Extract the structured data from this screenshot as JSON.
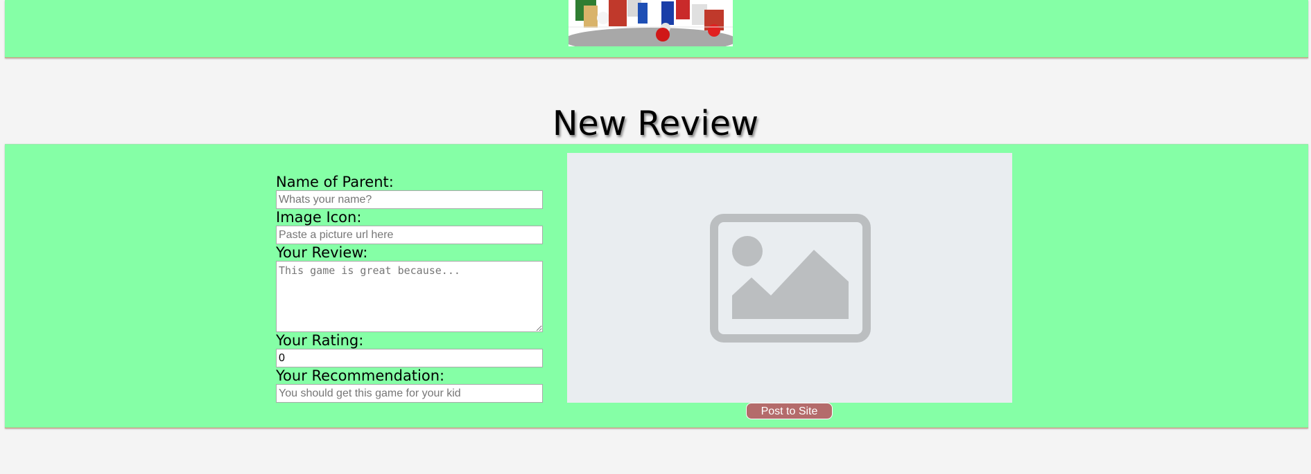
{
  "header": {
    "banner_image": "game-characters-banner"
  },
  "page": {
    "title": "New Review"
  },
  "form": {
    "parent_name": {
      "label": "Name of Parent:",
      "placeholder": "Whats your name?",
      "value": ""
    },
    "image_icon": {
      "label": "Image Icon:",
      "placeholder": "Paste a picture url here",
      "value": ""
    },
    "review": {
      "label": "Your Review:",
      "placeholder": "This game is great because...",
      "value": ""
    },
    "rating": {
      "label": "Your Rating:",
      "value": "0"
    },
    "recommendation": {
      "label": "Your Recommendation:",
      "placeholder": "You should get this game for your kid",
      "value": ""
    },
    "submit_label": "Post to Site"
  },
  "preview": {
    "icon": "image-placeholder-icon"
  },
  "colors": {
    "band_background": "#85ffa6",
    "page_background": "#f4f4f4",
    "button_background": "#b46b6b",
    "preview_background": "#e9edf0",
    "placeholder_icon": "#bbbec0"
  }
}
